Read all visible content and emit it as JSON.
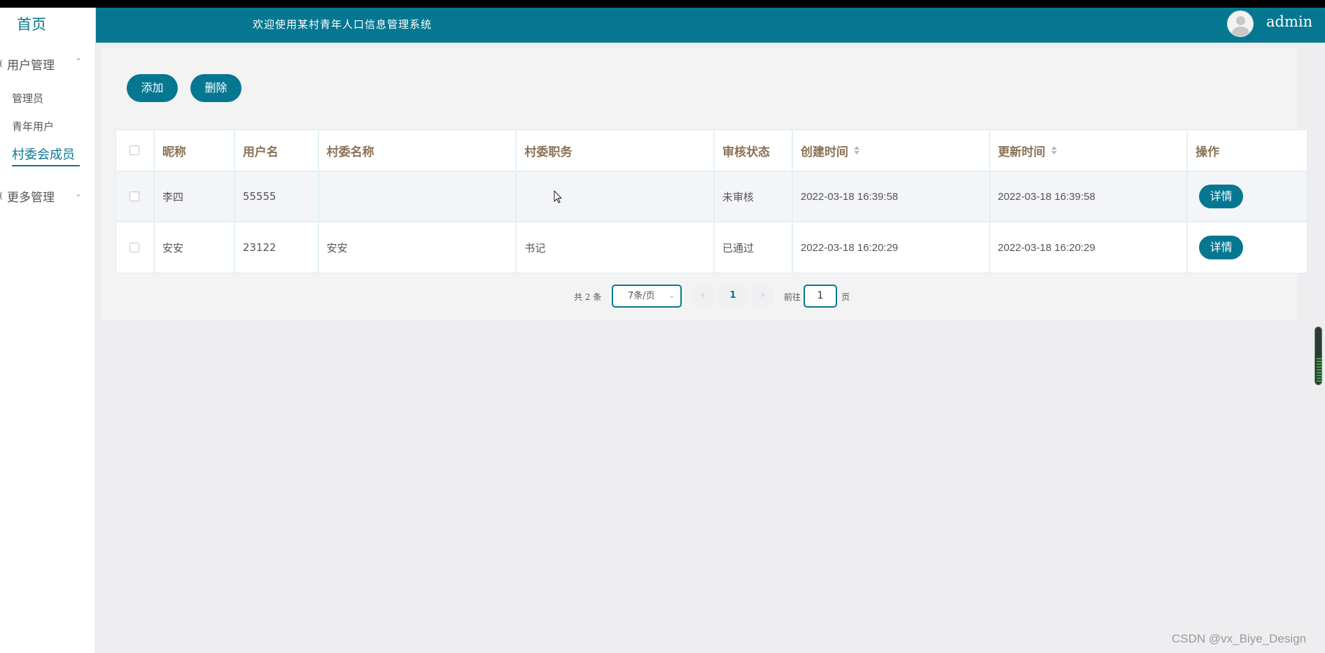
{
  "sidebar": {
    "home": "首页",
    "groups": [
      {
        "label": "用户管理",
        "chevron": "^",
        "expanded": true
      },
      {
        "label": "更多管理",
        "chevron": "v",
        "expanded": false
      }
    ],
    "items": [
      {
        "label": "管理员"
      },
      {
        "label": "青年用户"
      },
      {
        "label": "村委会成员",
        "active": true
      }
    ]
  },
  "header": {
    "welcome": "欢迎使用某村青年人口信息管理系统",
    "username": "admin",
    "avatar_icon": "user-avatar-icon"
  },
  "toolbar": {
    "add_label": "添加",
    "delete_label": "删除"
  },
  "table": {
    "columns": [
      "昵称",
      "用户名",
      "村委名称",
      "村委职务",
      "审核状态",
      "创建时间",
      "更新时间",
      "操作"
    ],
    "rows": [
      {
        "nickname": "李四",
        "username": "55555",
        "village_name": "",
        "village_position": "",
        "status": "未审核",
        "created": "2022-03-18 16:39:58",
        "updated": "2022-03-18 16:39:58",
        "action": "详情"
      },
      {
        "nickname": "安安",
        "username": "23122",
        "village_name": "安安",
        "village_position": "书记",
        "status": "已通过",
        "created": "2022-03-18 16:20:29",
        "updated": "2022-03-18 16:20:29",
        "action": "详情"
      }
    ]
  },
  "pagination": {
    "total": "共 2 条",
    "page_size": "7条/页",
    "current_page": "1",
    "goto_label": "前往",
    "goto_value": "1",
    "page_suffix": "页"
  },
  "watermark": "CSDN @vx_Biye_Design",
  "colors": {
    "primary": "#067791",
    "header_text": "#8b7355",
    "background": "#eeeef1"
  }
}
